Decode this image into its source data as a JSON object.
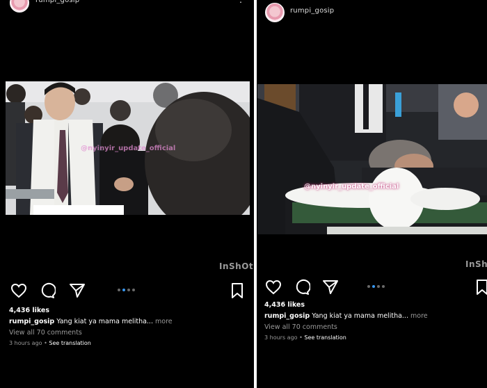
{
  "left_post": {
    "username": "rumpi_gosip",
    "more_glyph": "⋮",
    "watermark": "@nyinyir_update_official",
    "inshot": "InShOt",
    "likes": "4,436 likes",
    "caption_user": "rumpi_gosip",
    "caption_text": "Yang kiat ya mama melitha...",
    "caption_more": "more",
    "view_comments": "View all 70 comments",
    "time": "3 hours ago",
    "translation": "See translation",
    "carousel_dots": 4,
    "active_dot": 2
  },
  "right_post": {
    "username": "rumpi_gosip",
    "watermark": "@nyinyir_update_official",
    "inshot": "InShOt",
    "likes": "4,436 likes",
    "caption_user": "rumpi_gosip",
    "caption_text": "Yang kiat ya mama melitha...",
    "caption_more": "more",
    "view_comments": "View all 70 comments",
    "time": "3 hours ago",
    "translation": "See translation",
    "carousel_dots": 4,
    "active_dot": 1
  },
  "separator": "•",
  "colors": {
    "background": "#000000",
    "active_dot": "#3897f0",
    "muted_text": "#9a9a9a"
  }
}
